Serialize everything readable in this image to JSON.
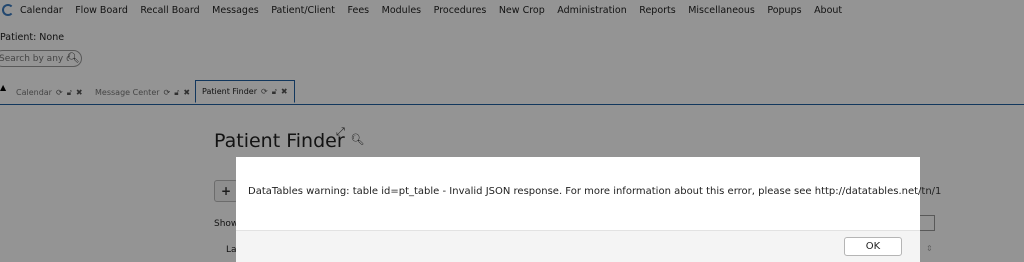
{
  "menu": {
    "items": [
      "Calendar",
      "Flow Board",
      "Recall Board",
      "Messages",
      "Patient/Client",
      "Fees",
      "Modules",
      "Procedures",
      "New Crop",
      "Administration",
      "Reports",
      "Miscellaneous",
      "Popups",
      "About"
    ]
  },
  "patient": {
    "label": "Patient: None"
  },
  "search": {
    "placeholder": "Search by any demographics"
  },
  "tabs": [
    {
      "label": "Calendar",
      "active": false
    },
    {
      "label": "Message Center",
      "active": false
    },
    {
      "label": "Patient Finder",
      "active": true
    }
  ],
  "page": {
    "title": "Patient Finder",
    "add_label": "+",
    "show_label": "Show",
    "column_partial": "La"
  },
  "dialog": {
    "message": "DataTables warning: table id=pt_table - Invalid JSON response. For more information about this error, please see http://datatables.net/tn/1",
    "ok_label": "OK"
  }
}
